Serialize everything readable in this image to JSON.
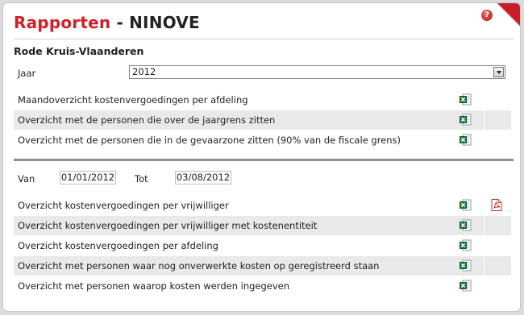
{
  "header": {
    "title_red": "Rapporten",
    "title_rest": " - NINOVE",
    "help_icon": "?"
  },
  "subtitle": "Rode Kruis-Vlaanderen",
  "jaar": {
    "label": "Jaar",
    "value": "2012"
  },
  "reports1": [
    {
      "label": "Maandoverzicht kostenvergoedingen per afdeling"
    },
    {
      "label": "Overzicht met de personen die over de jaargrens zitten"
    },
    {
      "label": "Overzicht met de personen die in de gevaarzone zitten (90% van de fiscale grens)"
    }
  ],
  "period": {
    "van_label": "Van",
    "van_value": "01/01/2012",
    "tot_label": "Tot",
    "tot_value": "03/08/2012"
  },
  "reports2": [
    {
      "label": "Overzicht kostenvergoedingen per vrijwilliger",
      "pdf": true
    },
    {
      "label": "Overzicht kostenvergoedingen per vrijwilliger met kostenentiteit",
      "pdf": false
    },
    {
      "label": "Overzicht kostenvergoedingen per afdeling",
      "pdf": false
    },
    {
      "label": "Overzicht met personen waar nog onverwerkte kosten op geregistreerd staan",
      "pdf": false
    },
    {
      "label": "Overzicht met personen waarop kosten werden ingegeven",
      "pdf": false
    }
  ],
  "icons": {
    "excel": "excel-icon",
    "pdf": "pdf-icon",
    "help": "help-icon"
  },
  "colors": {
    "accent": "#d0202a",
    "row_alt": "#e9e9e9",
    "separator": "#909090"
  }
}
